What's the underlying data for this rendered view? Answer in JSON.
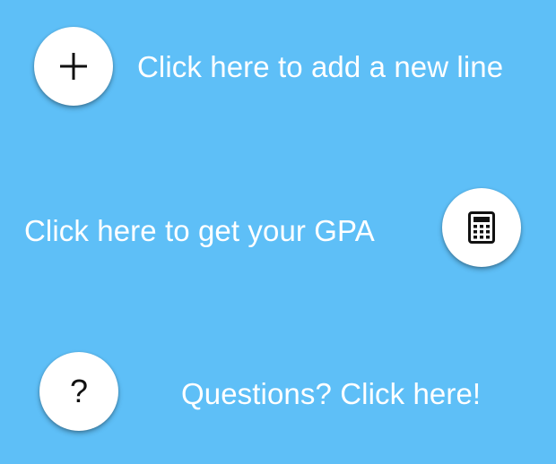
{
  "actions": {
    "add_line": {
      "icon": "plus-icon",
      "label": "Click here to add a new line"
    },
    "get_gpa": {
      "icon": "calculator-icon",
      "label": "Click here to get your GPA"
    },
    "help": {
      "icon": "question-mark-icon",
      "glyph": "?",
      "label": "Questions? Click here!"
    }
  },
  "colors": {
    "background": "#5ebff7",
    "button": "#ffffff",
    "text": "#ffffff",
    "icon": "#111111"
  }
}
